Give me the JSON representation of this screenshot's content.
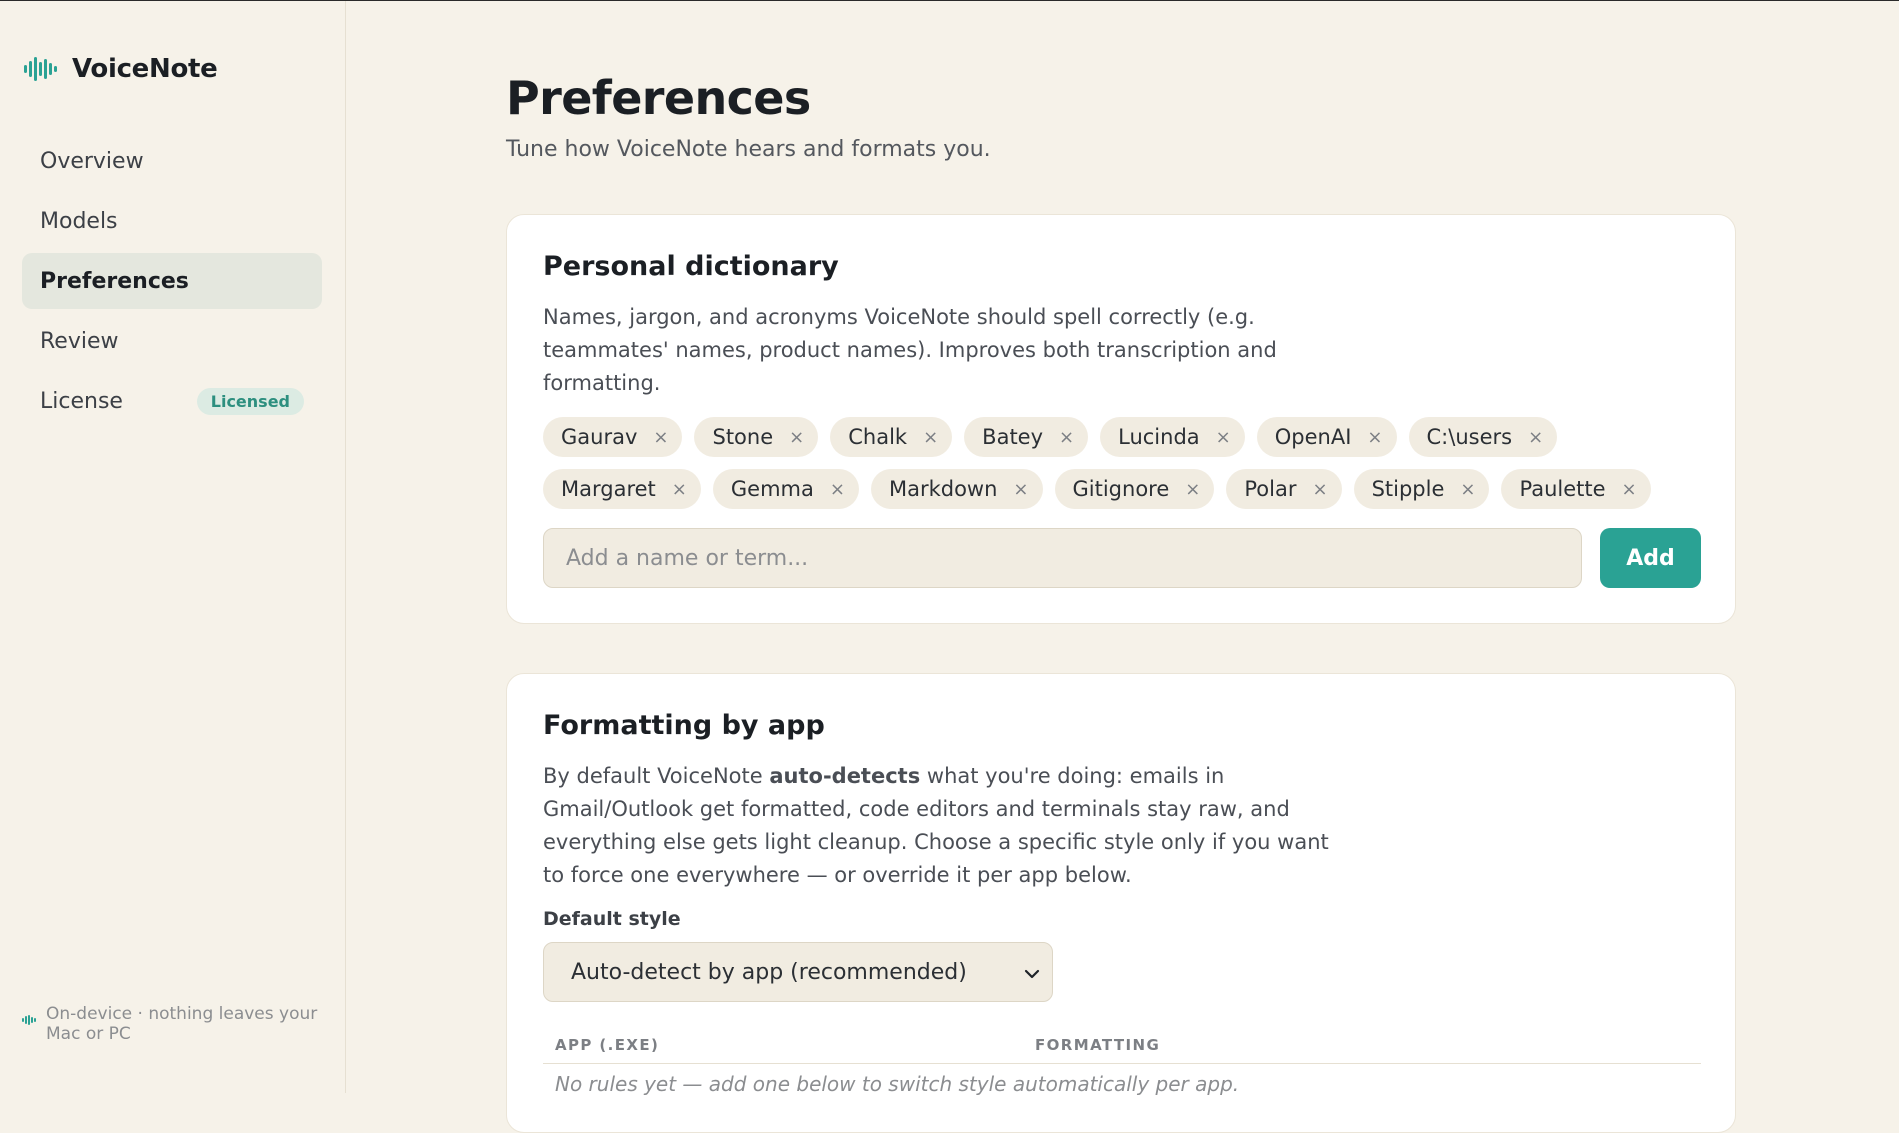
{
  "app": {
    "name": "VoiceNote"
  },
  "sidebar": {
    "items": [
      {
        "label": "Overview",
        "active": false
      },
      {
        "label": "Models",
        "active": false
      },
      {
        "label": "Preferences",
        "active": true
      },
      {
        "label": "Review",
        "active": false
      },
      {
        "label": "License",
        "active": false,
        "badge": "Licensed"
      }
    ],
    "footer_note": "On-device · nothing leaves your Mac or PC"
  },
  "page": {
    "title": "Preferences",
    "subtitle": "Tune how VoiceNote hears and formats you."
  },
  "dictionary": {
    "title": "Personal dictionary",
    "description": "Names, jargon, and acronyms VoiceNote should spell correctly (e.g. teammates' names, product names). Improves both transcription and formatting.",
    "tags": [
      "Gaurav",
      "Stone",
      "Chalk",
      "Batey",
      "Lucinda",
      "OpenAI",
      "C:\\users",
      "Margaret",
      "Gemma",
      "Markdown",
      "Gitignore",
      "Polar",
      "Stipple",
      "Paulette"
    ],
    "remove_glyph": "×",
    "input_placeholder": "Add a name or term...",
    "add_label": "Add"
  },
  "formatting": {
    "title": "Formatting by app",
    "description_pre": "By default VoiceNote ",
    "description_bold": "auto-detects",
    "description_post": " what you're doing: emails in Gmail/Outlook get formatted, code editors and terminals stay raw, and everything else gets light cleanup. Choose a specific style only if you want to force one everywhere — or override it per app below.",
    "default_style_label": "Default style",
    "default_style_value": "Auto-detect by app (recommended)",
    "columns": [
      "APP (.EXE)",
      "FORMATTING"
    ],
    "empty_text": "No rules yet — add one below to switch style automatically per app."
  },
  "colors": {
    "accent": "#2aa294",
    "background": "#f6f2e9",
    "active_nav": "#e4e7de",
    "badge_text": "#2d8f7f"
  }
}
